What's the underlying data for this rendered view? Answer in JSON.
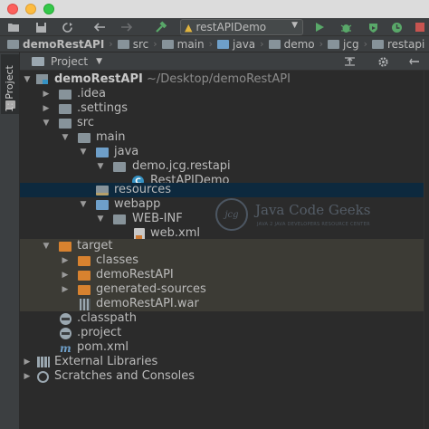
{
  "toolbar": {
    "run_config": "restAPIDemo"
  },
  "breadcrumb": [
    "demoRestAPI",
    "src",
    "main",
    "java",
    "demo",
    "jcg",
    "restapi"
  ],
  "tool_window_tab": "1: Project",
  "panel": {
    "title": "Project"
  },
  "tree": {
    "root_name": "demoRestAPI",
    "root_path": "~/Desktop/demoRestAPI",
    "idea": ".idea",
    "settings": ".settings",
    "src": "src",
    "main": "main",
    "java": "java",
    "package": "demo.jcg.restapi",
    "class": "RestAPIDemo",
    "resources": "resources",
    "webapp": "webapp",
    "webinf": "WEB-INF",
    "webxml": "web.xml",
    "target": "target",
    "classes": "classes",
    "target_module": "demoRestAPI",
    "generated": "generated-sources",
    "war": "demoRestAPI.war",
    "classpath": ".classpath",
    "project": ".project",
    "pom": "pom.xml",
    "external_libraries": "External Libraries",
    "scratches": "Scratches and Consoles"
  },
  "watermark": {
    "logo_text": "jcg",
    "title": "Java Code Geeks",
    "subtitle": "JAVA 2 JAVA DEVELOPERS RESOURCE CENTER"
  },
  "colors": {
    "background": "#2b2b2b",
    "panel": "#3c3f41",
    "selection": "#0d293e",
    "excluded": "#3c3b35",
    "source_folder": "#6e9fc9",
    "excluded_folder": "#d8822f"
  }
}
